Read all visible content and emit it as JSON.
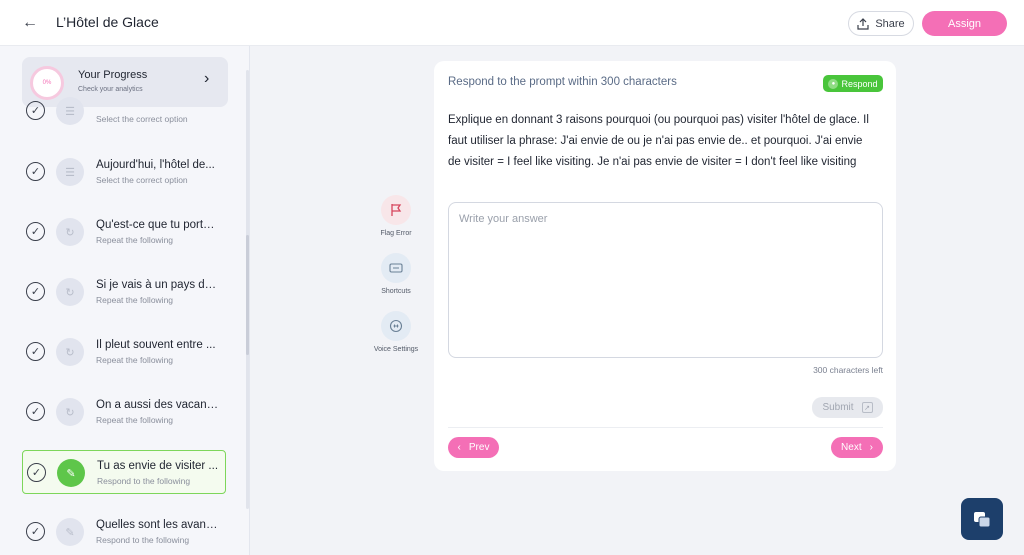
{
  "header": {
    "title": "L’Hôtel de Glace",
    "share_label": "Share",
    "assign_label": "Assign"
  },
  "progress": {
    "title": "Your Progress",
    "subtitle": "Check your analytics",
    "percent_label": "0%"
  },
  "sidebar": {
    "items": [
      {
        "title": "",
        "subtitle": "Select the correct option"
      },
      {
        "title": "Aujourd'hui, l'hôtel de...",
        "subtitle": "Select the correct option"
      },
      {
        "title": "Qu'est-ce que tu portes...",
        "subtitle": "Repeat the following"
      },
      {
        "title": "Si je vais à un pays de...",
        "subtitle": "Repeat the following"
      },
      {
        "title": "Il pleut souvent entre ...",
        "subtitle": "Repeat the following"
      },
      {
        "title": "On a aussi des vacances...",
        "subtitle": "Repeat the following"
      },
      {
        "title": "Tu as envie de visiter ...",
        "subtitle": "Respond to the following"
      },
      {
        "title": "Quelles sont les avantages...",
        "subtitle": "Respond to the following"
      }
    ]
  },
  "actions": {
    "flag_label": "Flag Error",
    "shortcuts_label": "Shortcuts",
    "voice_label": "Voice Settings"
  },
  "card": {
    "header": "Respond to the prompt within 300 characters",
    "badge": "Respond",
    "prompt": "Explique en donnant 3 raisons pourquoi (ou pourquoi pas) visiter l'hôtel de glace. Il faut utiliser la phrase: J'ai envie de ou je n'ai pas envie de.. et pourquoi. J'ai envie de visiter = I feel like visiting. Je n'ai pas envie de visiter = I don't feel like visiting",
    "answer_placeholder": "Write your answer",
    "answer_value": "",
    "chars_left": "300 characters left",
    "submit_label": "Submit",
    "prev_label": "Prev",
    "next_label": "Next"
  },
  "colors": {
    "accent_pink": "#f46fb6",
    "success_green": "#49c53b",
    "chat_navy": "#1d3f6b"
  }
}
